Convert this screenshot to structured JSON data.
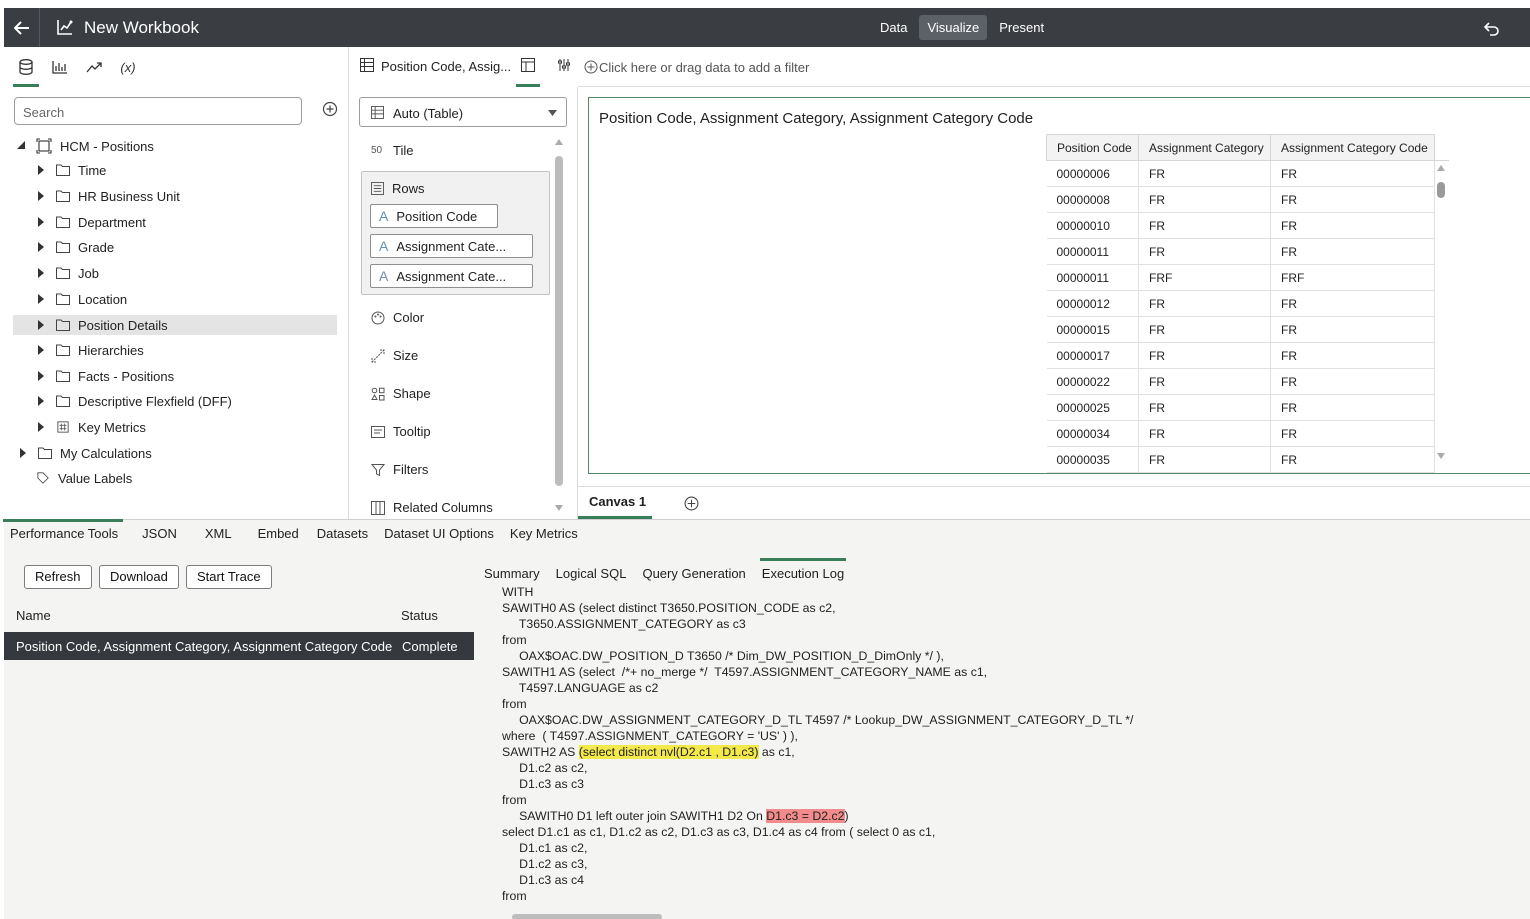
{
  "header": {
    "title": "New Workbook",
    "modes": [
      "Data",
      "Visualize",
      "Present"
    ],
    "active_mode": "Visualize"
  },
  "data_panel": {
    "search_placeholder": "Search",
    "tree": [
      {
        "label": "HCM - Positions",
        "level": 0,
        "expanded": true,
        "icon": "subject-area-icon"
      },
      {
        "label": "Time",
        "level": 1,
        "icon": "folder-icon"
      },
      {
        "label": "HR Business Unit",
        "level": 1,
        "icon": "folder-icon"
      },
      {
        "label": "Department",
        "level": 1,
        "icon": "folder-icon"
      },
      {
        "label": "Grade",
        "level": 1,
        "icon": "folder-icon"
      },
      {
        "label": "Job",
        "level": 1,
        "icon": "folder-icon"
      },
      {
        "label": "Location",
        "level": 1,
        "icon": "folder-icon"
      },
      {
        "label": "Position Details",
        "level": 1,
        "icon": "folder-icon",
        "selected": true
      },
      {
        "label": "Hierarchies",
        "level": 1,
        "icon": "folder-icon"
      },
      {
        "label": "Facts - Positions",
        "level": 1,
        "icon": "folder-icon"
      },
      {
        "label": "Descriptive Flexfield (DFF)",
        "level": 1,
        "icon": "folder-icon"
      },
      {
        "label": "Key Metrics",
        "level": 1,
        "icon": "metrics-icon"
      },
      {
        "label": "My Calculations",
        "level": 0,
        "icon": "folder-icon"
      },
      {
        "label": "Value Labels",
        "level": 0,
        "icon": "tag-icon"
      }
    ]
  },
  "grammar_panel": {
    "viz_label": "Position Code, Assig...",
    "viz_type": "Auto (Table)",
    "tile": "Tile",
    "rows_label": "Rows",
    "rows": [
      "Position Code",
      "Assignment Cate...",
      "Assignment Cate..."
    ],
    "props": [
      "Color",
      "Size",
      "Shape",
      "Tooltip",
      "Filters",
      "Related Columns"
    ]
  },
  "filter_bar": {
    "placeholder": "Click here or drag data to add a filter"
  },
  "viz": {
    "title": "Position Code, Assignment Category, Assignment Category Code",
    "columns": [
      "Position Code",
      "Assignment Category",
      "Assignment Category Code"
    ],
    "rows": [
      [
        "00000006",
        "FR",
        "FR"
      ],
      [
        "00000008",
        "FR",
        "FR"
      ],
      [
        "00000010",
        "FR",
        "FR"
      ],
      [
        "00000011",
        "FR",
        "FR"
      ],
      [
        "00000011",
        "FRF",
        "FRF"
      ],
      [
        "00000012",
        "FR",
        "FR"
      ],
      [
        "00000015",
        "FR",
        "FR"
      ],
      [
        "00000017",
        "FR",
        "FR"
      ],
      [
        "00000022",
        "FR",
        "FR"
      ],
      [
        "00000025",
        "FR",
        "FR"
      ],
      [
        "00000034",
        "FR",
        "FR"
      ],
      [
        "00000035",
        "FR",
        "FR"
      ]
    ]
  },
  "canvas_tabs": [
    "Canvas 1"
  ],
  "bottom": {
    "tabs": [
      "Performance Tools",
      "JSON",
      "XML",
      "Embed",
      "Datasets",
      "Dataset UI Options",
      "Key Metrics"
    ],
    "buttons": [
      "Refresh",
      "Download",
      "Start Trace"
    ],
    "list_headers": {
      "name": "Name",
      "status": "Status"
    },
    "query_row": {
      "name": "Position Code, Assignment Category, Assignment Category Code",
      "status": "Complete"
    },
    "log_tabs": [
      "Summary",
      "Logical SQL",
      "Query Generation",
      "Execution Log"
    ],
    "sql": {
      "l1": "WITH",
      "l2": "SAWITH0 AS (select distinct T3650.POSITION_CODE as c2,",
      "l3": "     T3650.ASSIGNMENT_CATEGORY as c3",
      "l4": "from",
      "l5": "     OAX$OAC.DW_POSITION_D T3650 /* Dim_DW_POSITION_D_DimOnly */ ),",
      "l6": "SAWITH1 AS (select  /*+ no_merge */  T4597.ASSIGNMENT_CATEGORY_NAME as c1,",
      "l7": "     T4597.LANGUAGE as c2",
      "l8": "from",
      "l9": "     OAX$OAC.DW_ASSIGNMENT_CATEGORY_D_TL T4597 /* Lookup_DW_ASSIGNMENT_CATEGORY_D_TL */",
      "l10": "where  ( T4597.ASSIGNMENT_CATEGORY = 'US' ) ),",
      "l11a": "SAWITH2 AS ",
      "l11b": "(select distinct nvl(D2.c1 , D1.c3)",
      "l11c": " as c1,",
      "l12": "     D1.c2 as c2,",
      "l13": "     D1.c3 as c3",
      "l14": "from",
      "l15a": "     SAWITH0 D1 left outer join SAWITH1 D2 On ",
      "l15b": "D1.c3 = D2.c2",
      "l15c": ")",
      "l16": "select D1.c1 as c1, D1.c2 as c2, D1.c3 as c3, D1.c4 as c4 from ( select 0 as c1,",
      "l17": "     D1.c1 as c2,",
      "l18": "     D1.c2 as c3,",
      "l19": "     D1.c3 as c4",
      "l20": "from"
    }
  },
  "colors": {
    "header_bg": "#3a3d42",
    "accent": "#3a7d5b",
    "highlight_yellow": "#f3e94a",
    "highlight_red": "#f28b8b"
  }
}
